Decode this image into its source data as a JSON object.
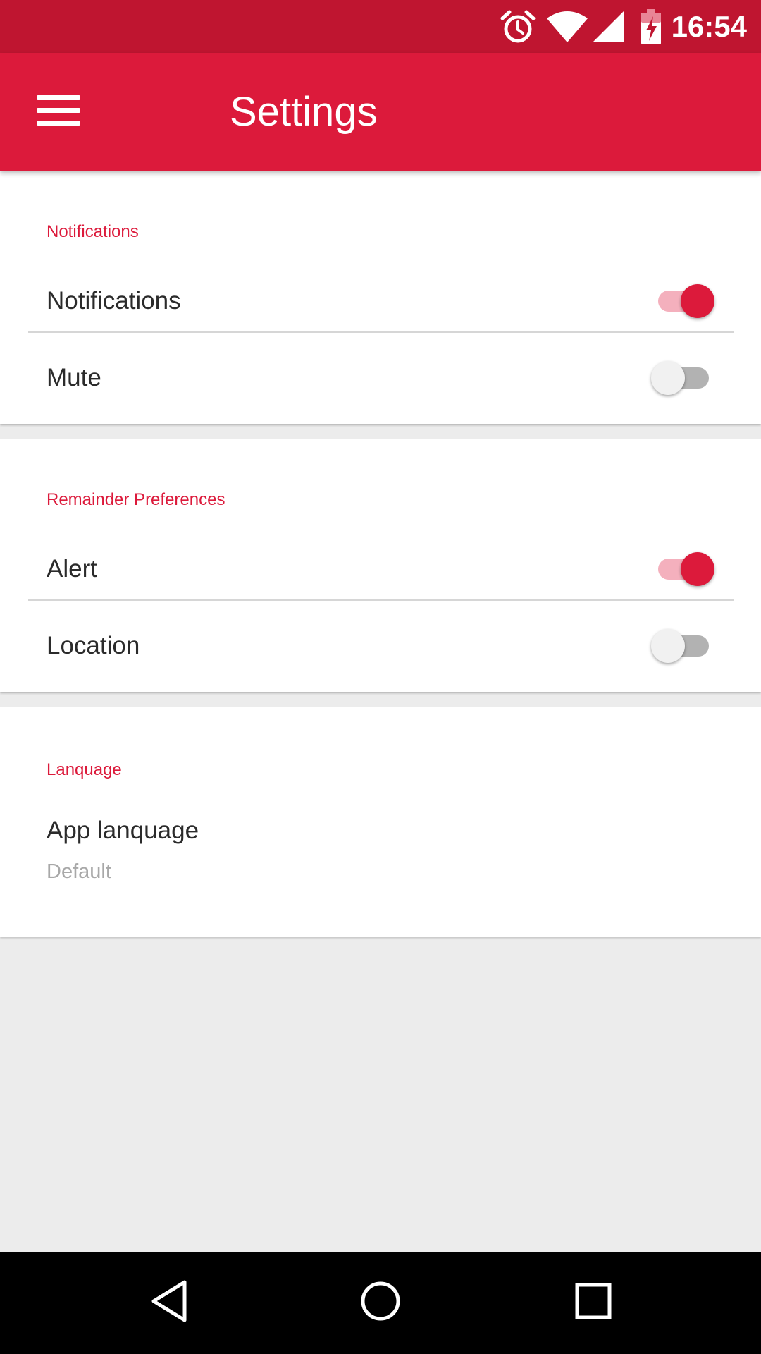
{
  "status_bar": {
    "time": "16:54",
    "icons": [
      "alarm-icon",
      "wifi-icon",
      "signal-icon",
      "battery-charging-icon"
    ],
    "background": "#bf1530"
  },
  "app_bar": {
    "title": "Settings",
    "menu_icon": "hamburger-menu-icon",
    "background": "#dc1a3b"
  },
  "sections": [
    {
      "header": "Notifications",
      "items": [
        {
          "label": "Notifications",
          "enabled": true
        },
        {
          "label": "Mute",
          "enabled": false
        }
      ]
    },
    {
      "header": "Remainder Preferences",
      "items": [
        {
          "label": "Alert",
          "enabled": true
        },
        {
          "label": "Location",
          "enabled": false
        }
      ]
    },
    {
      "header": "Lanquage",
      "items": [
        {
          "label": "App lanquage",
          "summary": "Default"
        }
      ]
    }
  ],
  "nav_bar": {
    "icons": [
      "back-icon",
      "home-icon",
      "recents-icon"
    ]
  },
  "colors": {
    "accent": "#dc1a3b",
    "switch_on_track": "#f4b0bd",
    "switch_off_track": "#b2b2b2",
    "page_background": "#ececec"
  }
}
